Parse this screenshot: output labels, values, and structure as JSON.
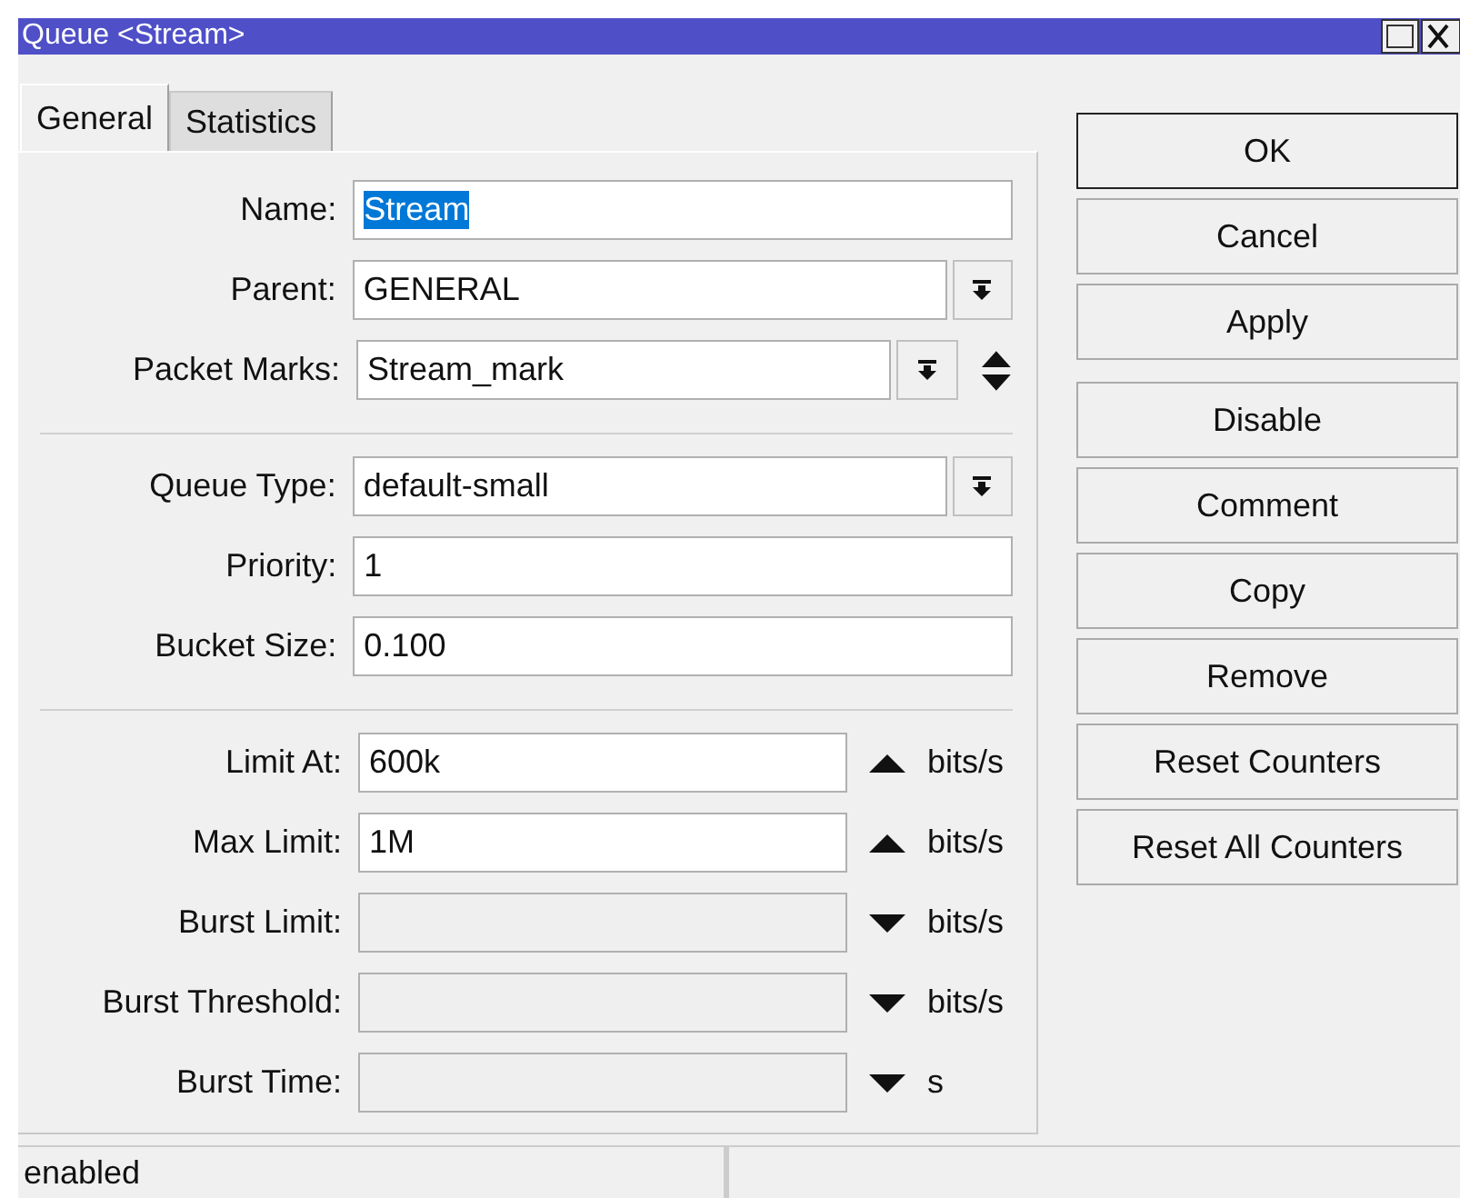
{
  "window": {
    "title": "Queue <Stream>"
  },
  "tabs": [
    {
      "label": "General",
      "selected": true
    },
    {
      "label": "Statistics",
      "selected": false
    }
  ],
  "sections": [
    {
      "fields": [
        {
          "kind": "text",
          "label": "Name:",
          "value": "Stream",
          "text_selected": true,
          "disabled": false
        },
        {
          "kind": "dropdown",
          "label": "Parent:",
          "value": "GENERAL",
          "disabled": false
        },
        {
          "kind": "multi",
          "label": "Packet Marks:",
          "value": "Stream_mark",
          "disabled": false
        }
      ]
    },
    {
      "fields": [
        {
          "kind": "dropdown",
          "label": "Queue Type:",
          "value": "default-small",
          "disabled": false
        },
        {
          "kind": "text",
          "label": "Priority:",
          "value": "1",
          "text_selected": false,
          "disabled": false
        },
        {
          "kind": "text",
          "label": "Bucket Size:",
          "value": "0.100",
          "text_selected": false,
          "disabled": false
        }
      ]
    },
    {
      "fields": [
        {
          "kind": "limit",
          "label": "Limit At:",
          "value": "600k",
          "expanded": true,
          "disabled": false,
          "unit": "bits/s"
        },
        {
          "kind": "limit",
          "label": "Max Limit:",
          "value": "1M",
          "expanded": true,
          "disabled": false,
          "unit": "bits/s"
        },
        {
          "kind": "limit",
          "label": "Burst Limit:",
          "expanded": false,
          "disabled": true,
          "unit": "bits/s"
        },
        {
          "kind": "limit",
          "label": "Burst Threshold:",
          "expanded": false,
          "disabled": true,
          "unit": "bits/s"
        },
        {
          "kind": "limit",
          "label": "Burst Time:",
          "expanded": false,
          "disabled": true,
          "unit": "s"
        }
      ]
    }
  ],
  "button_groups": [
    {
      "buttons": [
        {
          "label": "OK",
          "default": true
        },
        {
          "label": "Cancel",
          "default": false
        },
        {
          "label": "Apply",
          "default": false
        }
      ]
    },
    {
      "buttons": [
        {
          "label": "Disable",
          "default": false
        },
        {
          "label": "Comment",
          "default": false
        },
        {
          "label": "Copy",
          "default": false
        },
        {
          "label": "Remove",
          "default": false
        },
        {
          "label": "Reset Counters",
          "default": false
        },
        {
          "label": "Reset All Counters",
          "default": false
        }
      ]
    }
  ],
  "status_bar": {
    "text": "enabled"
  }
}
